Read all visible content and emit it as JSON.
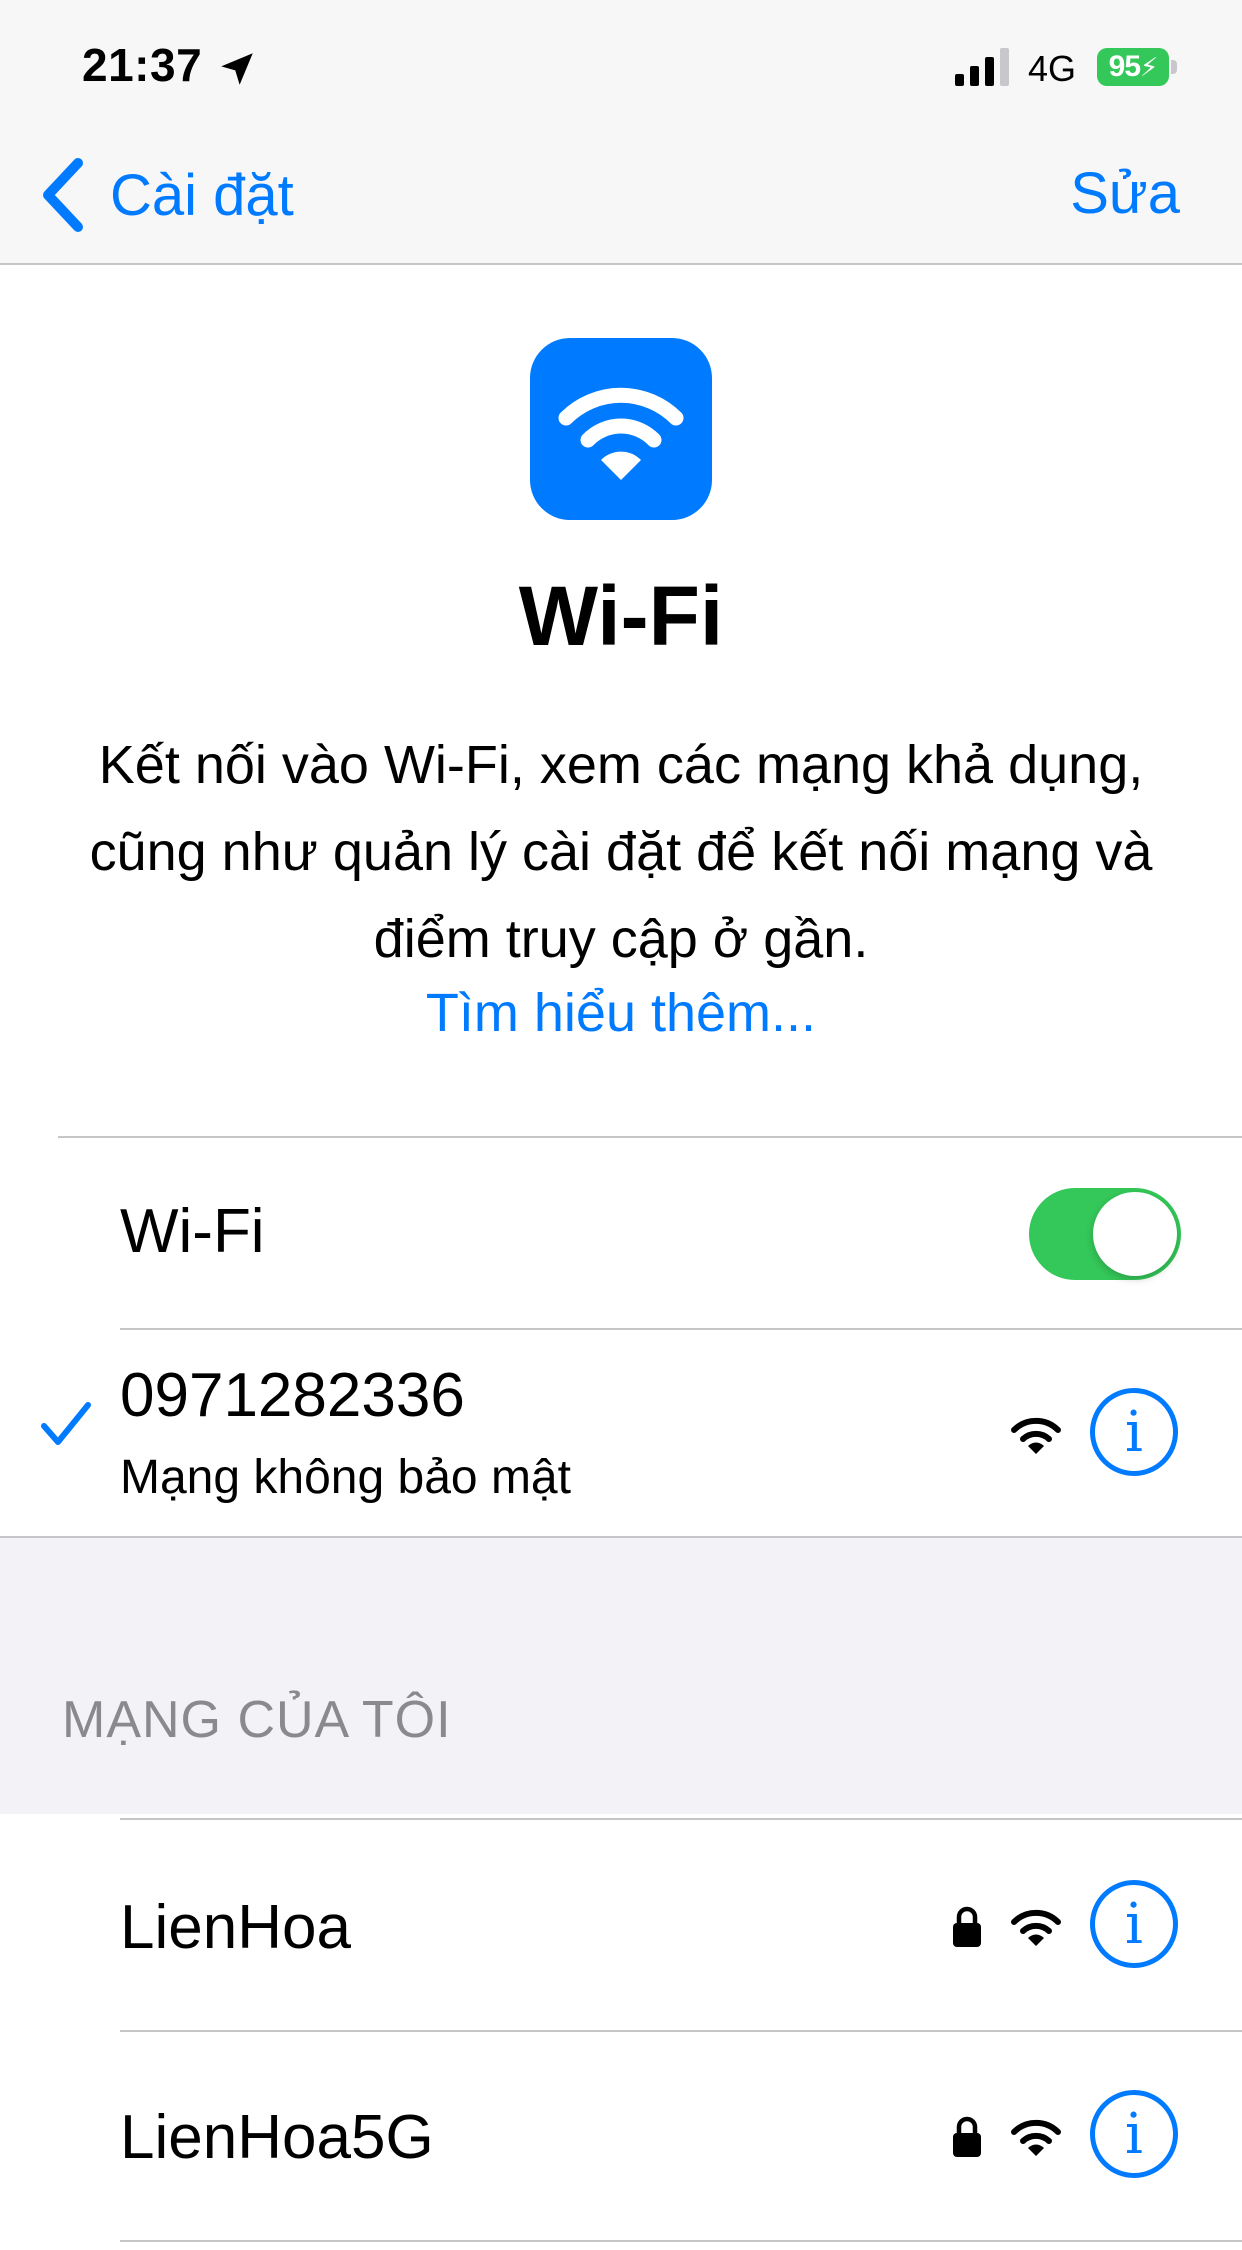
{
  "status_bar": {
    "time": "21:37",
    "network_type": "4G",
    "battery_level": "95"
  },
  "nav": {
    "back_label": "Cài đặt",
    "edit_label": "Sửa"
  },
  "hero": {
    "title": "Wi-Fi",
    "description": "Kết nối vào Wi-Fi, xem các mạng khả dụng, cũng như quản lý cài đặt để kết nối mạng và điểm truy cập ở gần.",
    "learn_more": "Tìm hiểu thêm..."
  },
  "wifi_toggle": {
    "label": "Wi-Fi",
    "enabled": true
  },
  "connected_network": {
    "name": "0971282336",
    "subtitle": "Mạng không bảo mật"
  },
  "my_networks": {
    "header": "MẠNG CỦA TÔI",
    "items": [
      {
        "name": "LienHoa",
        "secured": true
      },
      {
        "name": "LienHoa5G",
        "secured": true
      }
    ]
  },
  "colors": {
    "accent": "#007aff",
    "toggle_on": "#34c759",
    "battery": "#34c759",
    "section_bg": "#f2f2f7"
  },
  "icons": {
    "location": "location-arrow-icon",
    "signal": "cellular-signal-icon",
    "back": "chevron-left-icon",
    "wifi_hero": "wifi-icon",
    "check": "checkmark-icon",
    "wifi_strength": "wifi-signal-icon",
    "lock": "lock-icon",
    "info": "info-icon"
  }
}
